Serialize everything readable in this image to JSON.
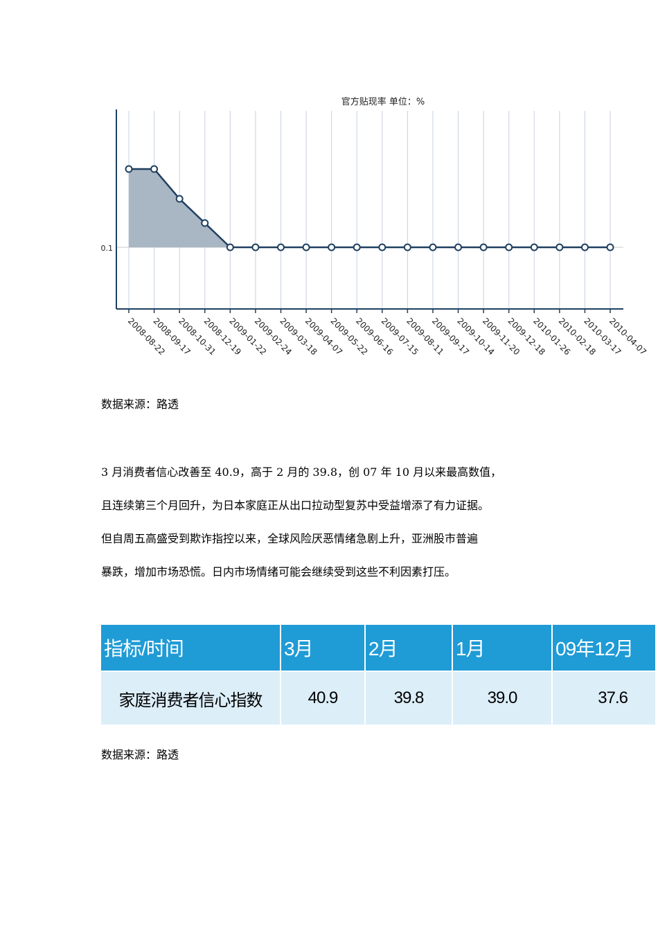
{
  "chart_data": {
    "type": "area",
    "title": "官方贴现率 单位：%",
    "categories": [
      "2008-08-22",
      "2008-09-17",
      "2008-10-31",
      "2008-12-19",
      "2009-01-22",
      "2009-02-24",
      "2009-03-18",
      "2009-04-07",
      "2009-05-22",
      "2009-06-16",
      "2009-07-15",
      "2009-08-11",
      "2009-09-17",
      "2009-10-14",
      "2009-11-20",
      "2009-12-18",
      "2010-01-26",
      "2010-02-18",
      "2010-03-17",
      "2010-04-07"
    ],
    "values": [
      0.5,
      0.5,
      0.3,
      0.3,
      0.1,
      0.1,
      0.1,
      0.1,
      0.1,
      0.1,
      0.1,
      0.1,
      0.1,
      0.1,
      0.1,
      0.1,
      0.1,
      0.1,
      0.1,
      0.1
    ],
    "yticks": [
      "0.1"
    ],
    "grid": "vertical",
    "colors": {
      "line": "#1f3f5f",
      "fill": "#a9b6c4",
      "grid": "#c9d0e4"
    }
  },
  "source1": "数据来源：路透",
  "paragraph": [
    "3 月消费者信心改善至 40.9，高于 2 月的 39.8，创 07 年 10 月以来最高数值，",
    "且连续第三个月回升，为日本家庭正从出口拉动型复苏中受益增添了有力证据。",
    "但自周五高盛受到欺诈指控以来，全球风险厌恶情绪急剧上升，亚洲股市普遍",
    "暴跌，增加市场恐慌。日内市场情绪可能会继续受到这些不利因素打压。"
  ],
  "table": {
    "headers": [
      "指标/时间",
      "3月",
      "2月",
      "1月",
      "09年12月"
    ],
    "row_label": "家庭消费者信心指数",
    "row_values": [
      "40.9",
      "39.8",
      "39.0",
      "37.6"
    ],
    "header_color": "#1f9bd6",
    "row_color": "#dceef8"
  },
  "source2": "数据来源：路透"
}
